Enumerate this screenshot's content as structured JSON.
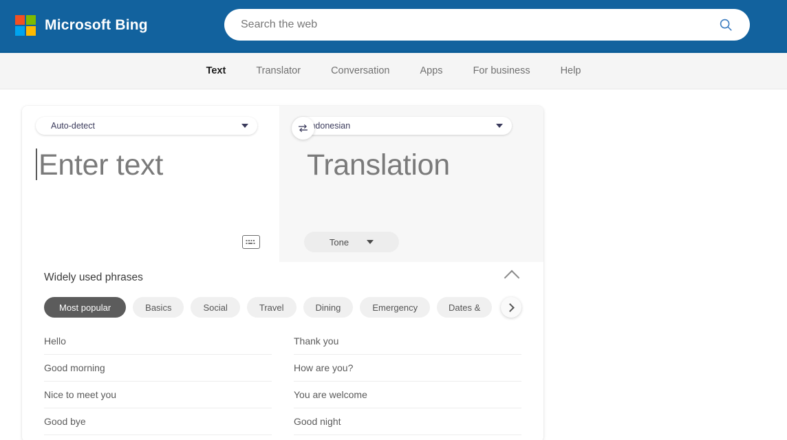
{
  "header": {
    "brand": "Microsoft Bing",
    "logo_icon": "microsoft-logo-icon",
    "search": {
      "placeholder": "Search the web",
      "value": "",
      "icon": "search-icon"
    },
    "background_color": "#12629e"
  },
  "nav": {
    "items": [
      {
        "label": "Text",
        "active": true
      },
      {
        "label": "Translator",
        "active": false
      },
      {
        "label": "Conversation",
        "active": false
      },
      {
        "label": "Apps",
        "active": false
      },
      {
        "label": "For business",
        "active": false
      },
      {
        "label": "Help",
        "active": false
      }
    ]
  },
  "translator": {
    "source": {
      "language": "Auto-detect",
      "placeholder": "Enter text",
      "keyboard_icon": "keyboard-icon"
    },
    "target": {
      "language": "Indonesian",
      "placeholder": "Translation",
      "tone_label": "Tone"
    },
    "swap_icon": "swap-arrows-icon",
    "dropdown_icon": "chevron-down-icon"
  },
  "phrases": {
    "title": "Widely used phrases",
    "collapse_icon": "chevron-up-icon",
    "next_icon": "chevron-right-icon",
    "categories": [
      {
        "label": "Most popular",
        "active": true
      },
      {
        "label": "Basics",
        "active": false
      },
      {
        "label": "Social",
        "active": false
      },
      {
        "label": "Travel",
        "active": false
      },
      {
        "label": "Dining",
        "active": false
      },
      {
        "label": "Emergency",
        "active": false
      },
      {
        "label": "Dates &",
        "active": false
      }
    ],
    "column_left": [
      "Hello",
      "Good morning",
      "Nice to meet you",
      "Good bye"
    ],
    "column_right": [
      "Thank you",
      "How are you?",
      "You are welcome",
      "Good night"
    ]
  }
}
